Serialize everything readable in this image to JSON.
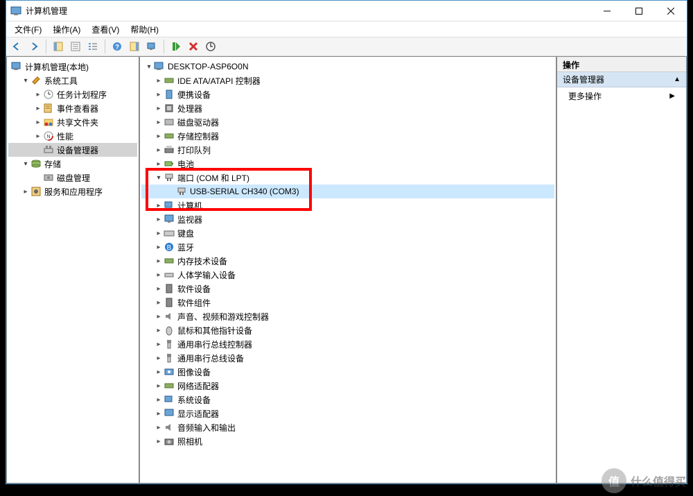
{
  "window": {
    "title": "计算机管理"
  },
  "menu": {
    "file": "文件(F)",
    "action": "操作(A)",
    "view": "查看(V)",
    "help": "帮助(H)"
  },
  "leftTree": {
    "root": "计算机管理(本地)",
    "systemTools": "系统工具",
    "taskScheduler": "任务计划程序",
    "eventViewer": "事件查看器",
    "sharedFolders": "共享文件夹",
    "performance": "性能",
    "deviceManager": "设备管理器",
    "storage": "存储",
    "diskMgmt": "磁盘管理",
    "servicesApps": "服务和应用程序"
  },
  "centerTree": {
    "root": "DESKTOP-ASP6O0N",
    "ide": "IDE ATA/ATAPI 控制器",
    "portable": "便携设备",
    "processor": "处理器",
    "diskDrive": "磁盘驱动器",
    "storageCtrl": "存储控制器",
    "printQueue": "打印队列",
    "battery": "电池",
    "ports": "端口 (COM 和 LPT)",
    "usbSerial": "USB-SERIAL CH340 (COM3)",
    "computer": "计算机",
    "monitor": "监视器",
    "keyboard": "键盘",
    "bluetooth": "蓝牙",
    "memory": "内存技术设备",
    "hid": "人体学输入设备",
    "softDevice": "软件设备",
    "softComponent": "软件组件",
    "sound": "声音、视频和游戏控制器",
    "mouse": "鼠标和其他指针设备",
    "usbCtrl": "通用串行总线控制器",
    "usbDevice": "通用串行总线设备",
    "imaging": "图像设备",
    "network": "网络适配器",
    "sysDevice": "系统设备",
    "display": "显示适配器",
    "audio": "音频输入和输出",
    "camera": "照相机"
  },
  "rightPanel": {
    "header": "操作",
    "section": "设备管理器",
    "moreActions": "更多操作"
  },
  "watermark": "什么值得买"
}
